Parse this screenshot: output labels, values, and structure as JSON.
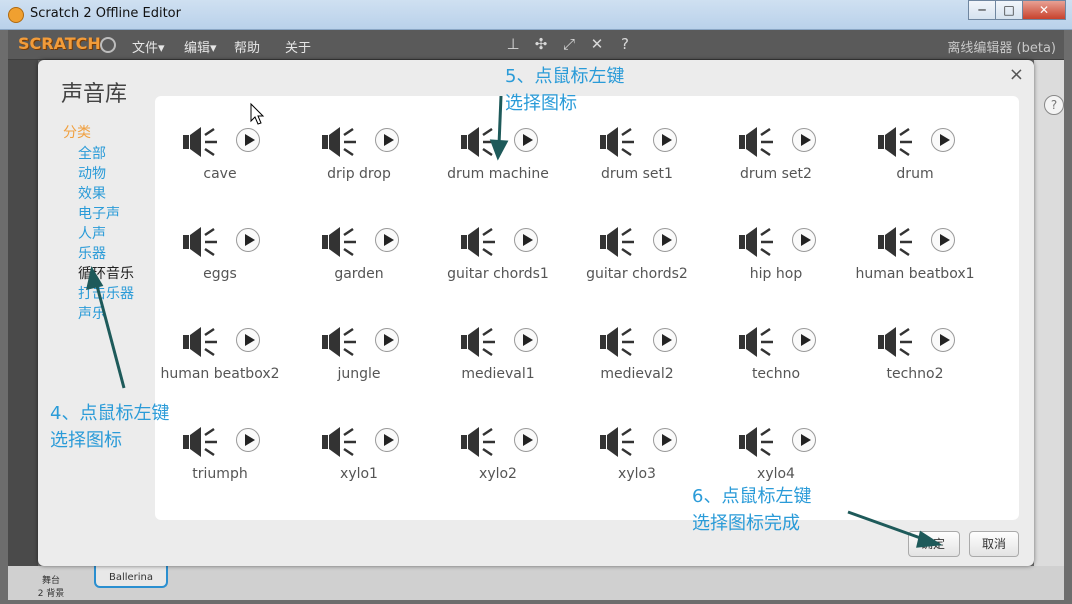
{
  "window": {
    "title": "Scratch 2 Offline Editor",
    "buttons": [
      "─",
      "□",
      "✕"
    ]
  },
  "menubar": {
    "logo": "SCRATCH",
    "items": [
      "文件▾",
      "编辑▾",
      "帮助",
      "关于"
    ],
    "tool_icons": [
      "stamp-icon",
      "cut-icon",
      "grow-icon",
      "shrink-icon",
      "help-icon"
    ],
    "offline_label": "离线编辑器 (beta)"
  },
  "background": {
    "stage_label": "舞台",
    "stage_backdrops": "2 背景",
    "sprite_name": "Ballerina",
    "help_glyph": "?"
  },
  "dialog": {
    "title": "声音库",
    "close": "×",
    "categories_label": "分类",
    "categories": [
      "全部",
      "动物",
      "效果",
      "电子声",
      "人声",
      "乐器",
      "循环音乐",
      "打击乐器",
      "声乐"
    ],
    "selected_category": 6,
    "sounds": [
      "cave",
      "drip drop",
      "drum machine",
      "drum set1",
      "drum set2",
      "drum",
      "eggs",
      "garden",
      "guitar chords1",
      "guitar chords2",
      "hip hop",
      "human beatbox1",
      "human beatbox2",
      "jungle",
      "medieval1",
      "medieval2",
      "techno",
      "techno2",
      "triumph",
      "xylo1",
      "xylo2",
      "xylo3",
      "xylo4"
    ],
    "ok_label": "确定",
    "cancel_label": "取消"
  },
  "annotations": {
    "step4": [
      "4、点鼠标左键",
      "选择图标"
    ],
    "step5": [
      "5、点鼠标左键",
      "选择图标"
    ],
    "step6": [
      "6、点鼠标左键",
      "选择图标完成"
    ],
    "color": "#2a9bd8",
    "arrow_color": "#1e5a5a"
  }
}
